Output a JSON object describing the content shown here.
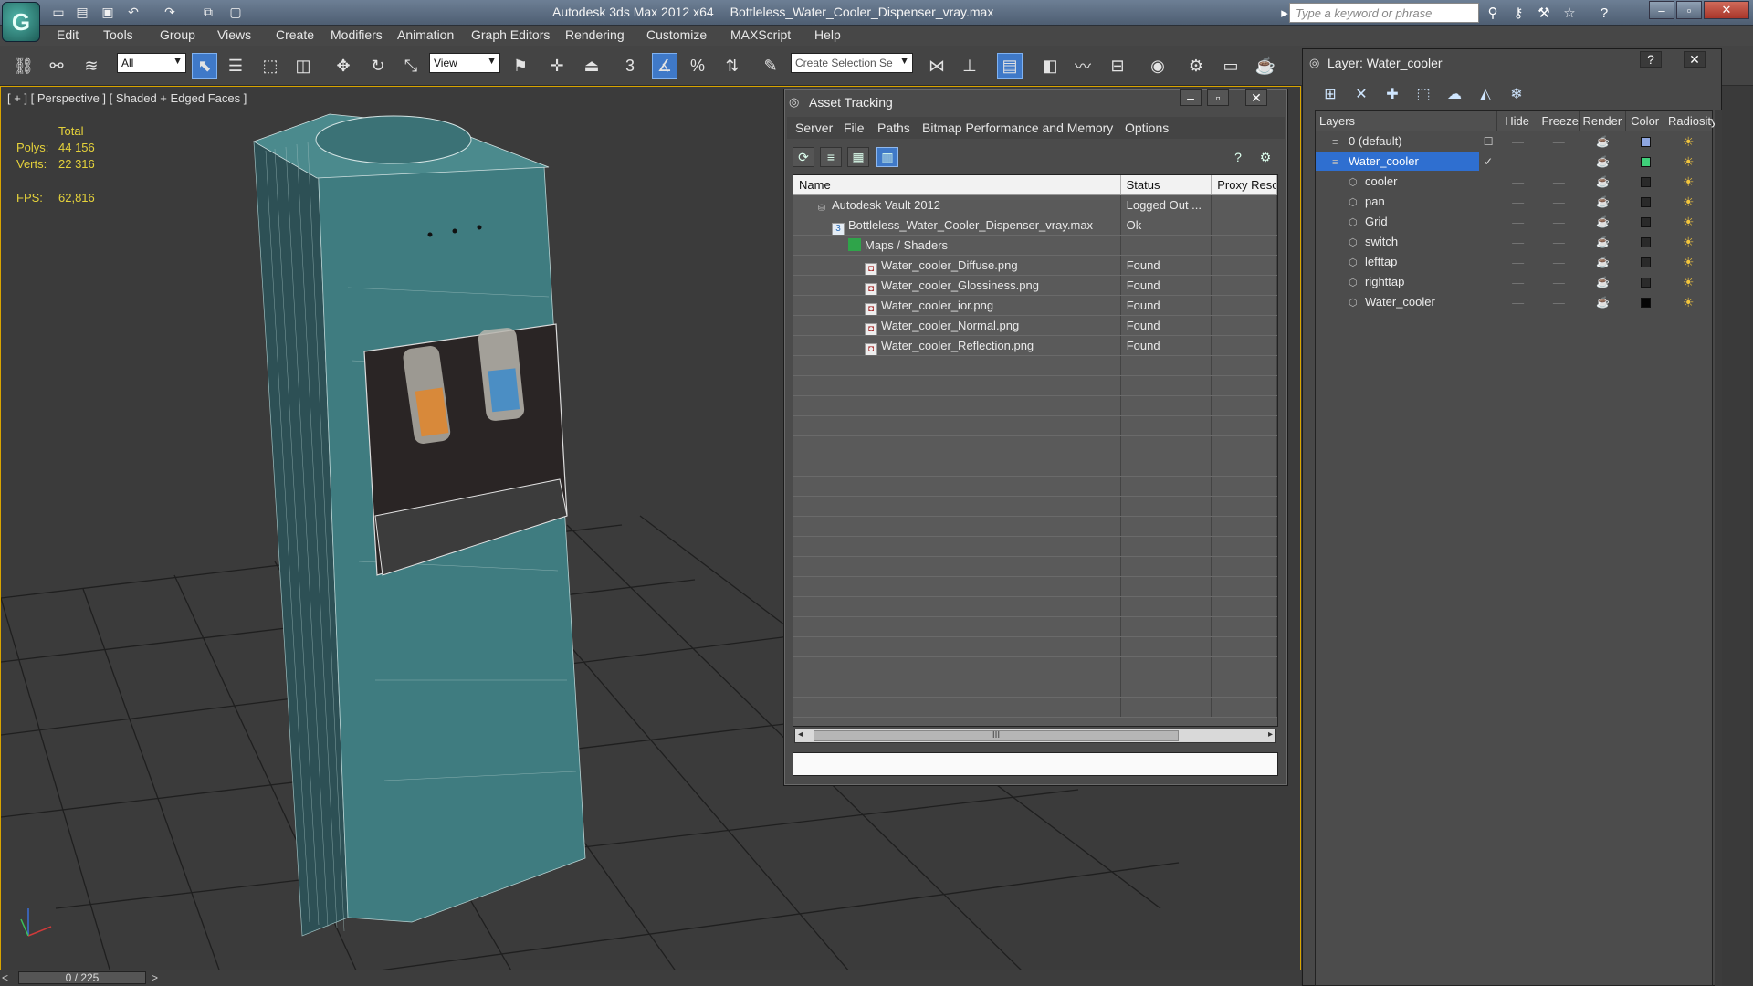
{
  "app": {
    "title": "Autodesk 3ds Max  2012 x64",
    "file": "Bottleless_Water_Cooler_Dispenser_vray.max",
    "search_placeholder": "Type a keyword or phrase"
  },
  "menu": [
    "Edit",
    "Tools",
    "Group",
    "Views",
    "Create",
    "Modifiers",
    "Animation",
    "Graph Editors",
    "Rendering",
    "Customize",
    "MAXScript",
    "Help"
  ],
  "toolbar": {
    "selection_filter": "All",
    "ref_coord": "View",
    "selection_set_placeholder": "Create Selection Se",
    "snap_label": "3",
    "angle_snap_label": "%"
  },
  "viewport": {
    "label": "[ + ] [ Perspective ] [ Shaded + Edged Faces ]",
    "stats": {
      "total_label": "Total",
      "polys_label": "Polys:",
      "polys_value": "44 156",
      "verts_label": "Verts:",
      "verts_value": "22 316",
      "fps_label": "FPS:",
      "fps_value": "62,816"
    },
    "time_slider": "0 / 225",
    "colors": {
      "cooler_body": "#3f7c80",
      "cooler_dark": "#2d5055",
      "hot_tap": "#d8893a",
      "cold_tap": "#4b8ec4",
      "grid": "#1e1e1e"
    }
  },
  "asset_tracking": {
    "title": "Asset Tracking",
    "menu": [
      "Server",
      "File",
      "Paths",
      "Bitmap Performance and Memory",
      "Options"
    ],
    "columns": [
      "Name",
      "Status",
      "Proxy Reso"
    ],
    "rows": [
      {
        "name": "Autodesk Vault 2012",
        "status": "Logged Out ...",
        "indent": 1,
        "icon": "vault-icon"
      },
      {
        "name": "Bottleless_Water_Cooler_Dispenser_vray.max",
        "status": "Ok",
        "indent": 2,
        "icon": "max-file-icon"
      },
      {
        "name": "Maps / Shaders",
        "status": "",
        "indent": 3,
        "icon": "maps-icon"
      },
      {
        "name": "Water_cooler_Diffuse.png",
        "status": "Found",
        "indent": 4,
        "icon": "bitmap-icon"
      },
      {
        "name": "Water_cooler_Glossiness.png",
        "status": "Found",
        "indent": 4,
        "icon": "bitmap-icon"
      },
      {
        "name": "Water_cooler_ior.png",
        "status": "Found",
        "indent": 4,
        "icon": "bitmap-icon"
      },
      {
        "name": "Water_cooler_Normal.png",
        "status": "Found",
        "indent": 4,
        "icon": "bitmap-icon"
      },
      {
        "name": "Water_cooler_Reflection.png",
        "status": "Found",
        "indent": 4,
        "icon": "bitmap-icon"
      }
    ],
    "scroll_thumb": "III"
  },
  "layers": {
    "title": "Layer: Water_cooler",
    "columns": [
      "Layers",
      "Hide",
      "Freeze",
      "Render",
      "Color",
      "Radiosity"
    ],
    "rows": [
      {
        "name": "0 (default)",
        "check": "☐",
        "color": "#8ea6e0",
        "selected": false,
        "indent": 1
      },
      {
        "name": "Water_cooler",
        "check": "✓",
        "color": "#3fd07a",
        "selected": true,
        "indent": 1
      },
      {
        "name": "cooler",
        "check": "",
        "color": "#2a2a2a",
        "selected": false,
        "indent": 2
      },
      {
        "name": "pan",
        "check": "",
        "color": "#2a2a2a",
        "selected": false,
        "indent": 2
      },
      {
        "name": "Grid",
        "check": "",
        "color": "#2a2a2a",
        "selected": false,
        "indent": 2
      },
      {
        "name": "switch",
        "check": "",
        "color": "#2a2a2a",
        "selected": false,
        "indent": 2
      },
      {
        "name": "lefttap",
        "check": "",
        "color": "#2a2a2a",
        "selected": false,
        "indent": 2
      },
      {
        "name": "righttap",
        "check": "",
        "color": "#2a2a2a",
        "selected": false,
        "indent": 2
      },
      {
        "name": "Water_cooler",
        "check": "",
        "color": "#050505",
        "selected": false,
        "indent": 2
      }
    ]
  }
}
